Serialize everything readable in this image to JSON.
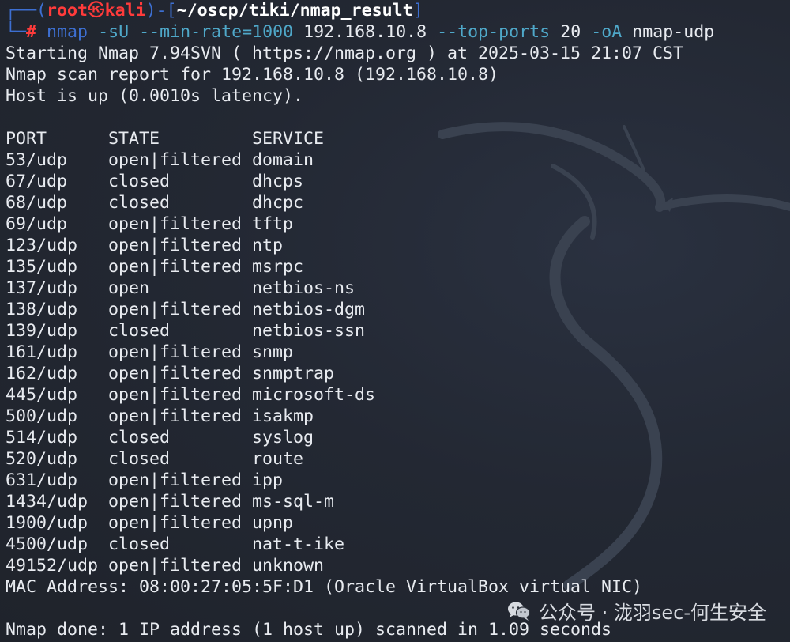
{
  "prompt": {
    "frame_top": "┌──(",
    "user": "root",
    "skull": "㉿",
    "host": "kali",
    "frame_mid": ")-[",
    "path": "~/oscp/tiki/nmap_result",
    "frame_end": "]",
    "frame_bottom": "└─",
    "hash": "#"
  },
  "command": {
    "program": "nmap",
    "flag1": "-sU",
    "flag2": "--min-rate=1000",
    "target": "192.168.10.8",
    "flag3": "--top-ports",
    "flag3_value": "20",
    "flag4": "-oA",
    "output_name": "nmap-udp"
  },
  "output": {
    "start": "Starting Nmap 7.94SVN ( https://nmap.org ) at 2025-03-15 21:07 CST",
    "report": "Nmap scan report for 192.168.10.8 (192.168.10.8)",
    "hostup": "Host is up (0.0010s latency).",
    "header": {
      "port": "PORT",
      "state": "STATE",
      "service": "SERVICE"
    },
    "ports": [
      {
        "port": "53/udp",
        "state": "open|filtered",
        "service": "domain"
      },
      {
        "port": "67/udp",
        "state": "closed",
        "service": "dhcps"
      },
      {
        "port": "68/udp",
        "state": "closed",
        "service": "dhcpc"
      },
      {
        "port": "69/udp",
        "state": "open|filtered",
        "service": "tftp"
      },
      {
        "port": "123/udp",
        "state": "open|filtered",
        "service": "ntp"
      },
      {
        "port": "135/udp",
        "state": "open|filtered",
        "service": "msrpc"
      },
      {
        "port": "137/udp",
        "state": "open",
        "service": "netbios-ns"
      },
      {
        "port": "138/udp",
        "state": "open|filtered",
        "service": "netbios-dgm"
      },
      {
        "port": "139/udp",
        "state": "closed",
        "service": "netbios-ssn"
      },
      {
        "port": "161/udp",
        "state": "open|filtered",
        "service": "snmp"
      },
      {
        "port": "162/udp",
        "state": "open|filtered",
        "service": "snmptrap"
      },
      {
        "port": "445/udp",
        "state": "open|filtered",
        "service": "microsoft-ds"
      },
      {
        "port": "500/udp",
        "state": "open|filtered",
        "service": "isakmp"
      },
      {
        "port": "514/udp",
        "state": "closed",
        "service": "syslog"
      },
      {
        "port": "520/udp",
        "state": "closed",
        "service": "route"
      },
      {
        "port": "631/udp",
        "state": "open|filtered",
        "service": "ipp"
      },
      {
        "port": "1434/udp",
        "state": "open|filtered",
        "service": "ms-sql-m"
      },
      {
        "port": "1900/udp",
        "state": "open|filtered",
        "service": "upnp"
      },
      {
        "port": "4500/udp",
        "state": "closed",
        "service": "nat-t-ike"
      },
      {
        "port": "49152/udp",
        "state": "open|filtered",
        "service": "unknown"
      }
    ],
    "mac": "MAC Address: 08:00:27:05:5F:D1 (Oracle VirtualBox virtual NIC)",
    "done": "Nmap done: 1 IP address (1 host up) scanned in 1.09 seconds"
  },
  "watermark": {
    "icon": "wechat-icon",
    "text": "公众号 · 泷羽sec-何生安全"
  },
  "colors": {
    "background": "#21252e",
    "prompt_blue": "#3d6fd1",
    "user_red": "#ff3b3b",
    "option_cyan": "#4fa8c9",
    "text": "#e8ebf0"
  }
}
